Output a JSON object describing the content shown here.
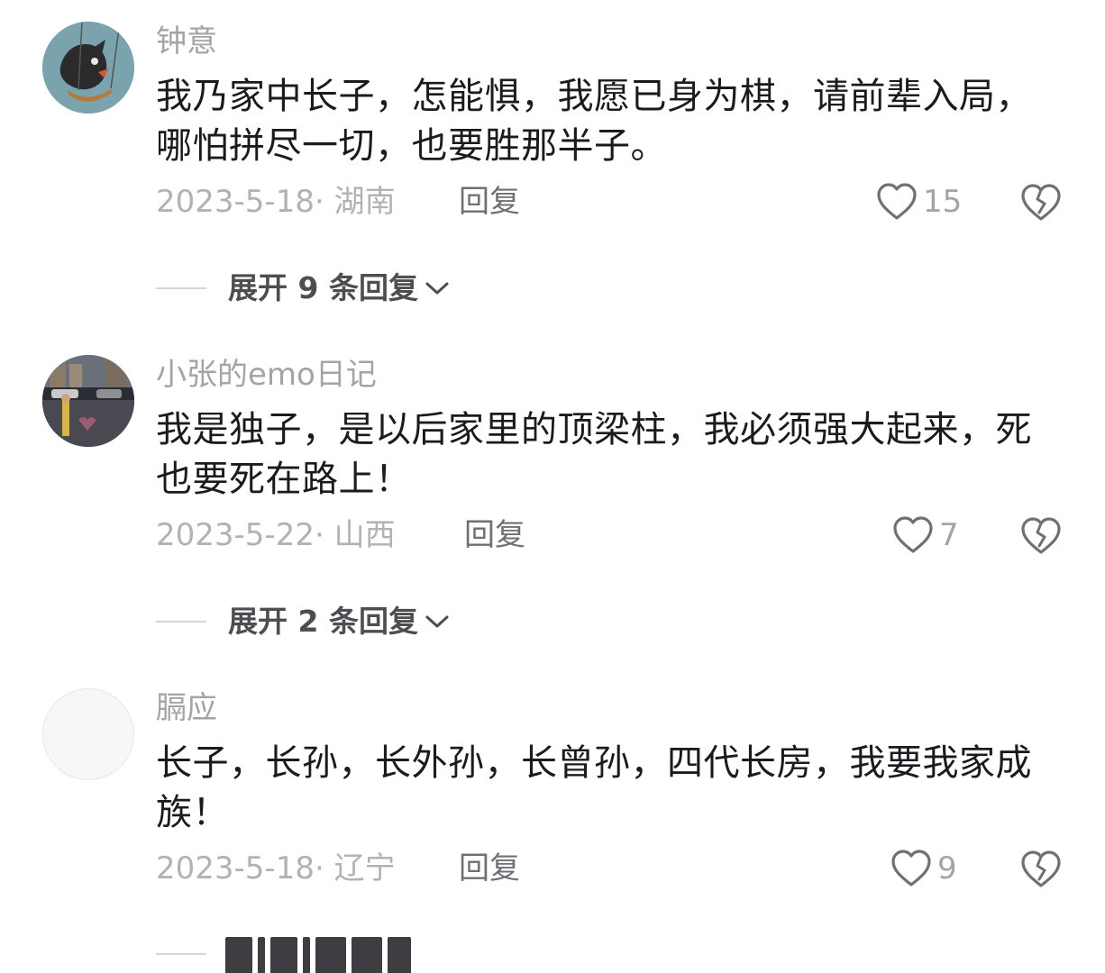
{
  "comments": [
    {
      "username": "钟意",
      "text": "我乃家中长子，怎能惧，我愿已身为棋，请前辈入局，哪怕拼尽一切，也要胜那半子。",
      "meta": "2023-5-18· 湖南",
      "reply_label": "回复",
      "likes": "15",
      "expand_label": "展开 9 条回复"
    },
    {
      "username": "小张的emo日记",
      "text": "我是独子，是以后家里的顶梁柱，我必须强大起来，死也要死在路上！",
      "meta": "2023-5-22· 山西",
      "reply_label": "回复",
      "likes": "7",
      "expand_label": "展开 2 条回复"
    },
    {
      "username": "膈应",
      "text": "长子，长孙，长外孙，长曾孙，四代长房，我要我家成族！",
      "meta": "2023-5-18· 辽宁",
      "reply_label": "回复",
      "likes": "9"
    }
  ],
  "icons": {
    "like": "heart-outline-icon",
    "dislike": "broken-heart-icon",
    "expand": "chevron-down-icon"
  },
  "colors": {
    "text": "#1b1b1f",
    "muted": "#a3a3a8",
    "icon": "#6f6f75"
  }
}
